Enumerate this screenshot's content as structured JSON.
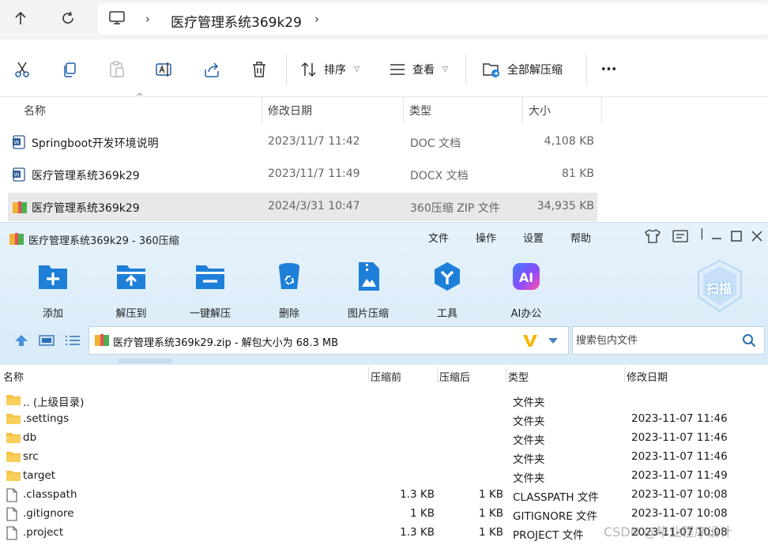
{
  "explorer": {
    "breadcrumb_title": "医疗管理系统369k29",
    "toolbar": {
      "sort_label": "排序",
      "view_label": "查看",
      "extract_all_label": "全部解压缩",
      "more_label": "•••"
    },
    "columns": {
      "name": "名称",
      "modified": "修改日期",
      "type": "类型",
      "size": "大小"
    },
    "files": [
      {
        "name": "Springboot开发环境说明",
        "modified": "2023/11/7 11:42",
        "type": "DOC 文档",
        "size": "4,108 KB"
      },
      {
        "name": "医疗管理系统369k29",
        "modified": "2023/11/7 11:49",
        "type": "DOCX 文档",
        "size": "81 KB"
      },
      {
        "name": "医疗管理系统369k29",
        "modified": "2024/3/31 10:47",
        "type": "360压缩 ZIP 文件",
        "size": "34,935 KB"
      }
    ]
  },
  "zipwin": {
    "title": "医疗管理系统369k29 - 360压缩",
    "menu": [
      "文件",
      "操作",
      "设置",
      "帮助"
    ],
    "buttons": [
      "添加",
      "解压到",
      "一键解压",
      "删除",
      "图片压缩",
      "工具",
      "AI办公"
    ],
    "scan_label": "扫描",
    "path_text": "医疗管理系统369k29.zip - 解包大小为 68.3 MB",
    "search_placeholder": "搜索包内文件",
    "columns": {
      "name": "名称",
      "before": "压缩前",
      "after": "压缩后",
      "type": "类型",
      "modified": "修改日期"
    },
    "rows": [
      {
        "name": ".. (上级目录)",
        "before": "",
        "after": "",
        "type": "文件夹",
        "modified": "",
        "kind": "folder"
      },
      {
        "name": ".settings",
        "before": "",
        "after": "",
        "type": "文件夹",
        "modified": "2023-11-07 11:46",
        "kind": "folder"
      },
      {
        "name": "db",
        "before": "",
        "after": "",
        "type": "文件夹",
        "modified": "2023-11-07 11:46",
        "kind": "folder"
      },
      {
        "name": "src",
        "before": "",
        "after": "",
        "type": "文件夹",
        "modified": "2023-11-07 11:46",
        "kind": "folder"
      },
      {
        "name": "target",
        "before": "",
        "after": "",
        "type": "文件夹",
        "modified": "2023-11-07 11:49",
        "kind": "folder"
      },
      {
        "name": ".classpath",
        "before": "1.3 KB",
        "after": "1 KB",
        "type": "CLASSPATH 文件",
        "modified": "2023-11-07 10:08",
        "kind": "file"
      },
      {
        "name": ".gitignore",
        "before": "1 KB",
        "after": "1 KB",
        "type": "GITIGNORE 文件",
        "modified": "2023-11-07 10:08",
        "kind": "file"
      },
      {
        "name": ".project",
        "before": "1.3 KB",
        "after": "1 KB",
        "type": "PROJECT 文件",
        "modified": "2023-11-07 10:08",
        "kind": "file"
      }
    ]
  },
  "watermark": "CSDN @毕业程序设计",
  "colors": {
    "folder": "#f5c242",
    "accent_blue": "#1e7fd8",
    "window_bg": "#dcecf9"
  }
}
